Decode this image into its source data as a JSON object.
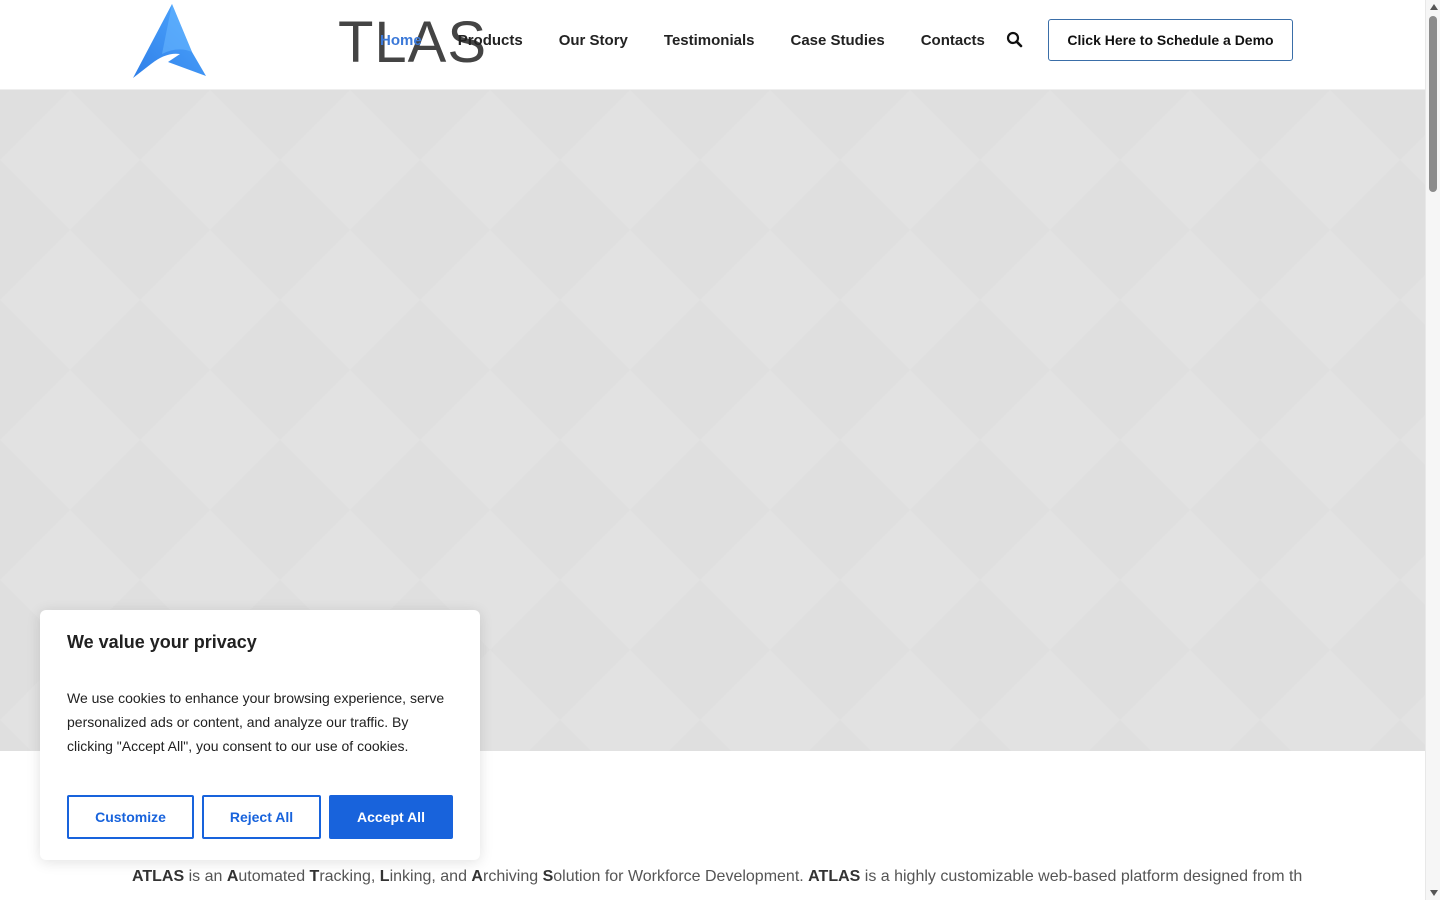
{
  "header": {
    "logo_text": "TLAS",
    "logo_icon": "atlas-a-logo-icon",
    "nav": [
      {
        "label": "Home",
        "active": true
      },
      {
        "label": "Products",
        "active": false
      },
      {
        "label": "Our Story",
        "active": false
      },
      {
        "label": "Testimonials",
        "active": false
      },
      {
        "label": "Case Studies",
        "active": false
      },
      {
        "label": "Contacts",
        "active": false
      }
    ],
    "search_icon": "search-icon",
    "demo_button": "Click Here to Schedule a Demo"
  },
  "intro": {
    "parts": [
      {
        "t": "ATLAS",
        "b": true
      },
      {
        "t": " is an ",
        "b": false
      },
      {
        "t": "A",
        "b": true
      },
      {
        "t": "utomated ",
        "b": false
      },
      {
        "t": "T",
        "b": true
      },
      {
        "t": "racking, ",
        "b": false
      },
      {
        "t": "L",
        "b": true
      },
      {
        "t": "inking, and ",
        "b": false
      },
      {
        "t": "A",
        "b": true
      },
      {
        "t": "rchiving ",
        "b": false
      },
      {
        "t": "S",
        "b": true
      },
      {
        "t": "olution for Workforce Development. ",
        "b": false
      },
      {
        "t": "ATLAS",
        "b": true
      },
      {
        "t": " is a highly customizable web-based platform designed from the",
        "b": false
      }
    ]
  },
  "cookie_banner": {
    "title": "We value your privacy",
    "text": "We use cookies to enhance your browsing experience, serve personalized ads or content, and analyze our traffic. By clicking \"Accept All\", you consent to our use of cookies.",
    "customize": "Customize",
    "reject": "Reject All",
    "accept": "Accept All"
  },
  "colors": {
    "accent": "#3a78d8",
    "cookie_primary": "#1863dc",
    "hero_bg": "#e2e2e2"
  }
}
